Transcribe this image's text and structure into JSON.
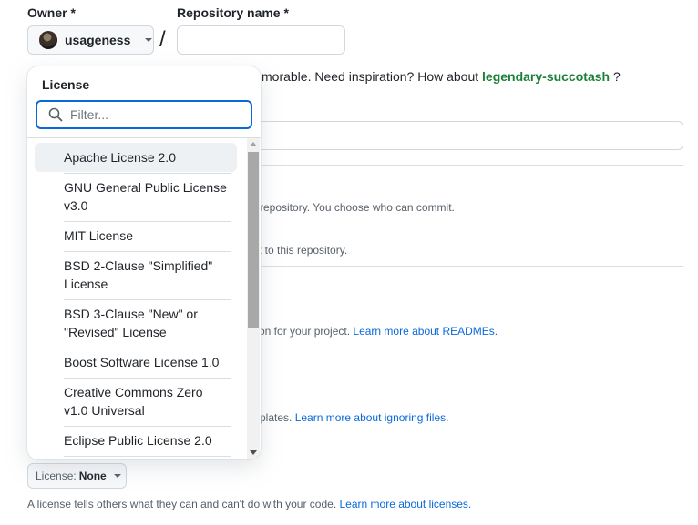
{
  "owner": {
    "label": "Owner *",
    "value": "usageness"
  },
  "repository": {
    "label": "Repository name *",
    "value": "",
    "separator": "/"
  },
  "suggestion": {
    "prefix": "morable. Need inspiration? How about",
    "name": "legendary-succotash",
    "suffix": "?"
  },
  "background": {
    "visibility_public_desc": "repository. You choose who can commit.",
    "visibility_private_desc": "t to this repository.",
    "readme_desc": "on for your project.",
    "readme_link": "Learn more about READMEs.",
    "gitignore_desc": "plates.",
    "gitignore_link": "Learn more about ignoring files."
  },
  "license_button": {
    "label": "License:",
    "value": "None"
  },
  "license_help": {
    "text": "A license tells others what they can and can't do with your code.",
    "link": "Learn more about licenses."
  },
  "dropdown": {
    "title": "License",
    "filter_placeholder": "Filter...",
    "items": [
      "Apache License 2.0",
      "GNU General Public License v3.0",
      "MIT License",
      "BSD 2-Clause \"Simplified\" License",
      "BSD 3-Clause \"New\" or \"Revised\" License",
      "Boost Software License 1.0",
      "Creative Commons Zero v1.0 Universal",
      "Eclipse Public License 2.0"
    ]
  },
  "icons": {
    "filter": "search-icon",
    "owner_caret": "chevron-down-icon",
    "license_caret": "chevron-down-icon"
  },
  "colors": {
    "accent_blue": "#0969da",
    "link_green": "#1a7f37",
    "border": "#d0d7de"
  }
}
